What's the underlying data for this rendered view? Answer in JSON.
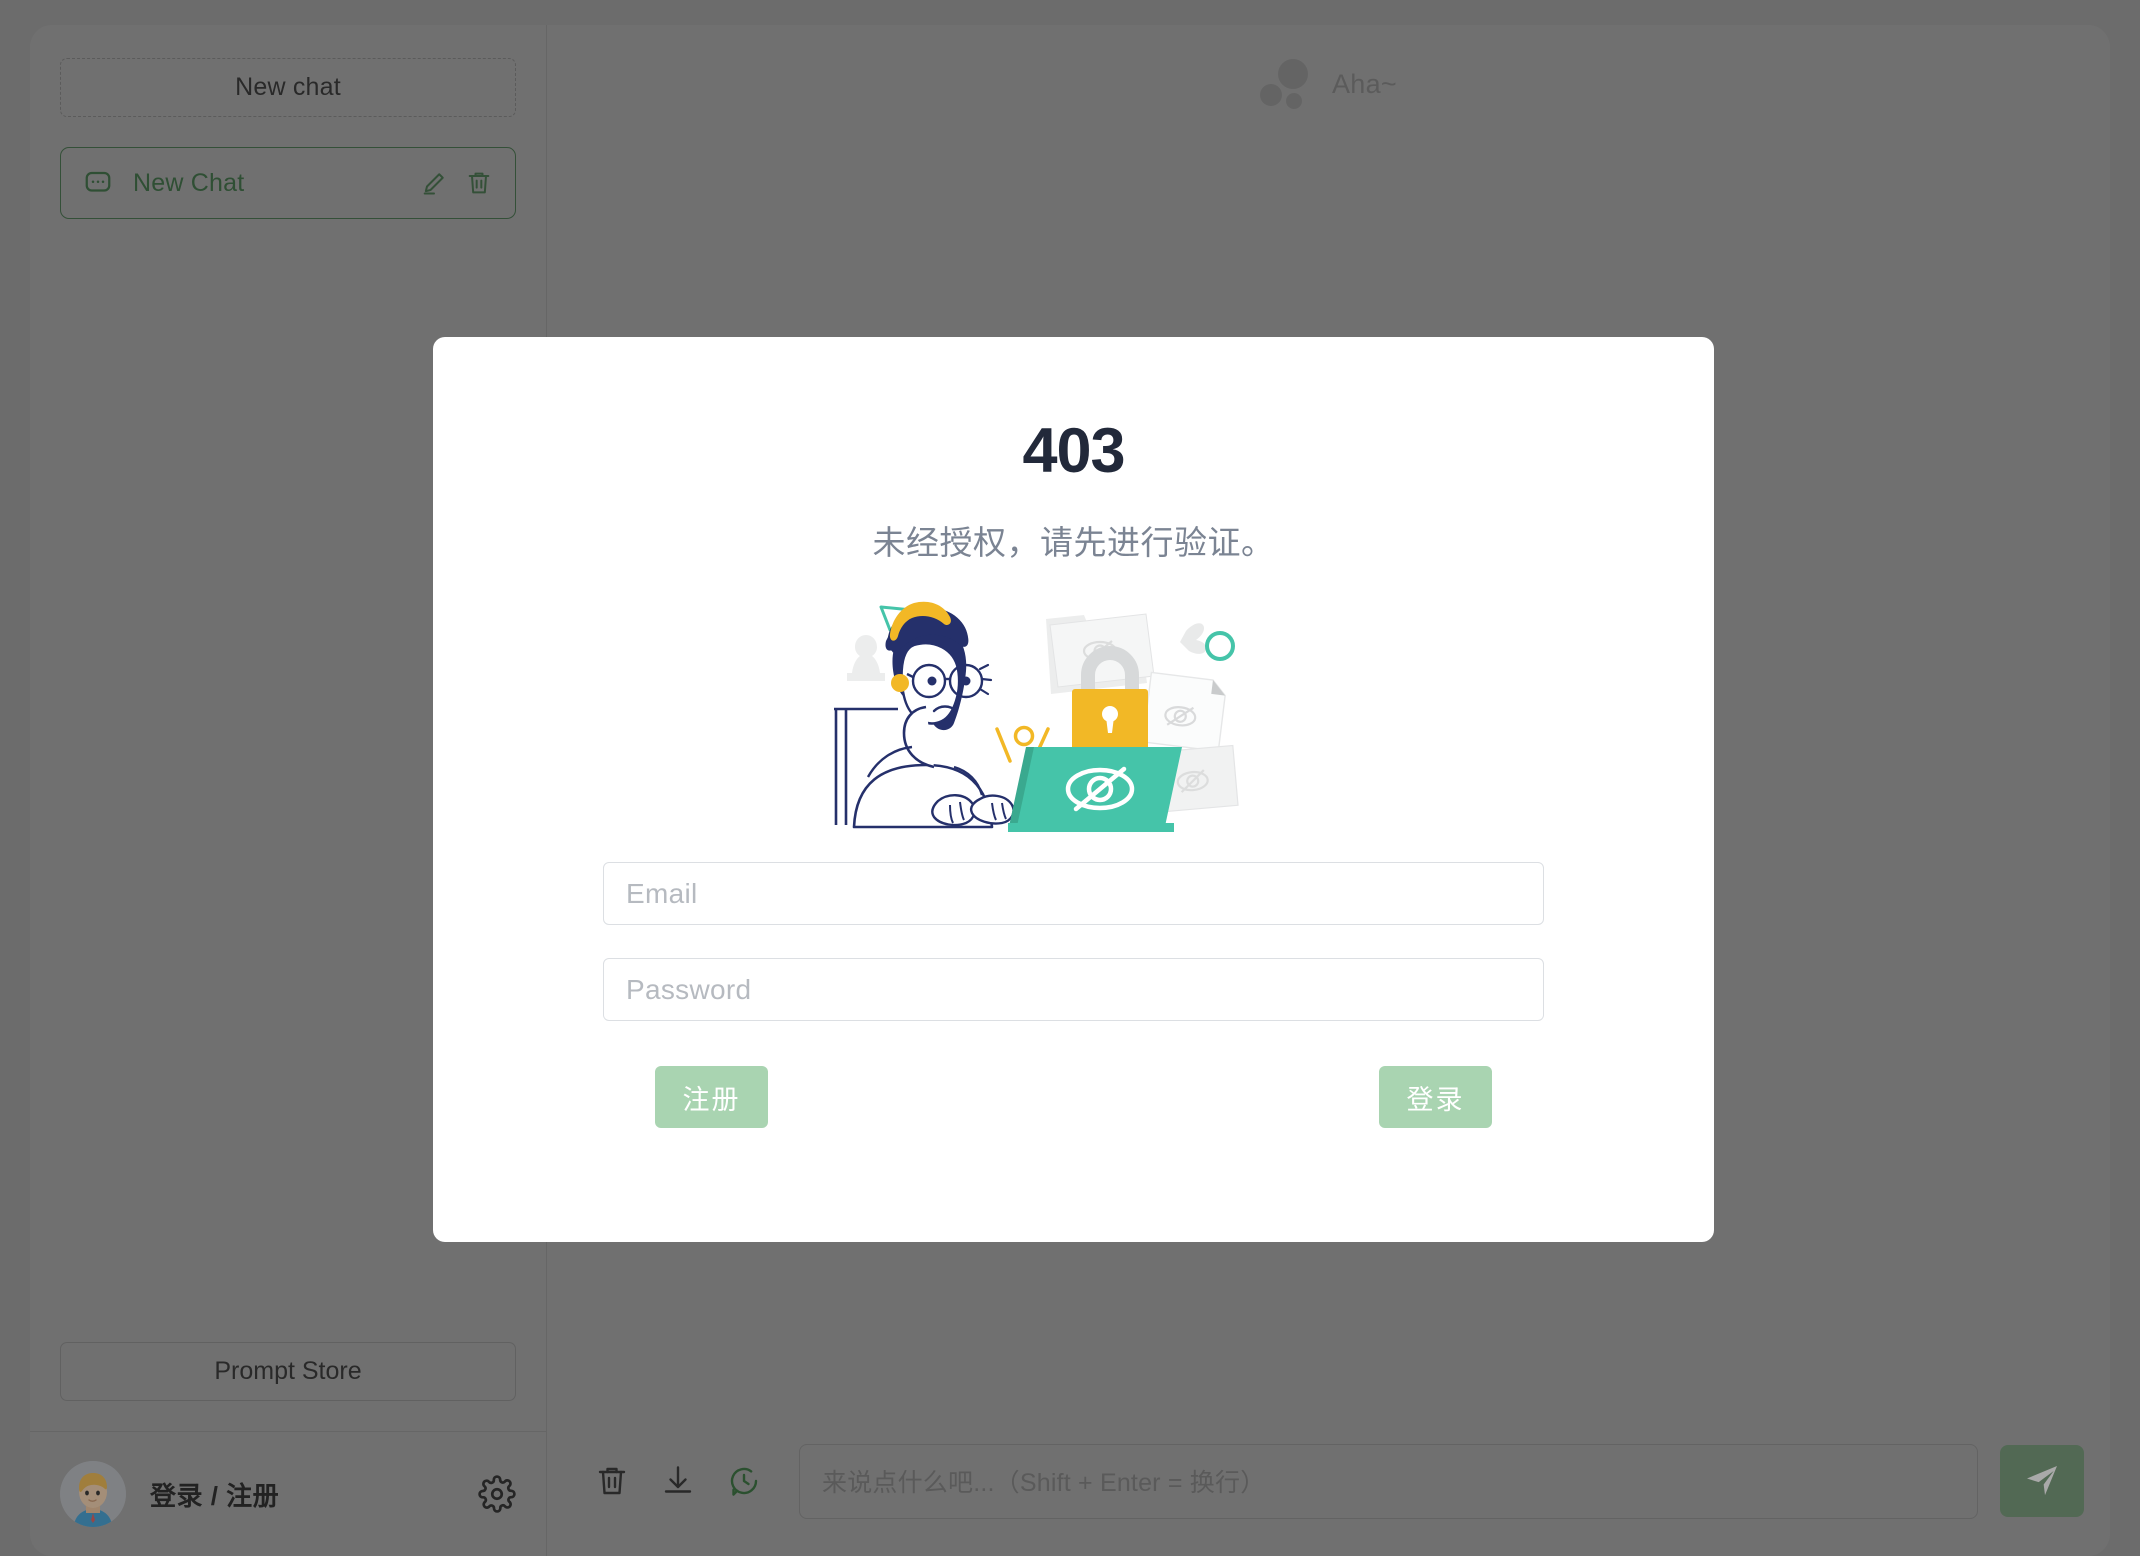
{
  "app": {
    "brand_name": "Aha~",
    "brand_icon": "three-dots-logo"
  },
  "sidebar": {
    "new_chat_label": "New chat",
    "chat_items": [
      {
        "label": "New Chat",
        "icon": "chat-bubble-icon",
        "edit_icon": "pencil-icon",
        "delete_icon": "trash-icon",
        "active": true
      }
    ],
    "prompt_store_label": "Prompt Store",
    "footer": {
      "avatar_icon": "user-avatar",
      "login_label": "登录 / 注册",
      "settings_icon": "gear-icon"
    }
  },
  "composer": {
    "tools": [
      {
        "name": "clear-conversation",
        "icon": "trash-icon"
      },
      {
        "name": "export-conversation",
        "icon": "download-icon"
      },
      {
        "name": "conversation-history",
        "icon": "chat-history-icon"
      }
    ],
    "placeholder": "来说点什么吧...（Shift + Enter = 换行）",
    "send_icon": "send-plane-icon"
  },
  "modal": {
    "title": "403",
    "subtitle": "未经授权，请先进行验证。",
    "illustration": "unauthorized-person-illustration",
    "email": {
      "value": "",
      "placeholder": "Email"
    },
    "password": {
      "value": "",
      "placeholder": "Password"
    },
    "register_label": "注册",
    "login_label": "登录"
  },
  "colors": {
    "accent_green": "#a9d4b1",
    "send_green": "#6f9472",
    "sidebar_active": "#34693c",
    "title_navy": "#22293a",
    "subtitle_gray": "#7b8493",
    "illustration_teal": "#45c4a9",
    "illustration_navy": "#25306b",
    "illustration_yellow": "#f2b826"
  }
}
